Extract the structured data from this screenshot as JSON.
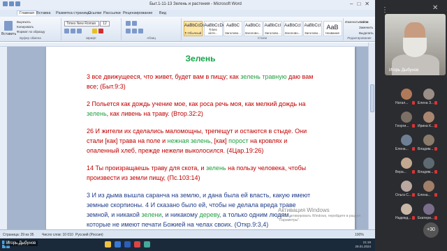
{
  "word": {
    "window_title": "Быт.1-11-13 Зелень и растения - Microsoft Word",
    "tabs": [
      "Главная",
      "Вставка",
      "Разметка страницы",
      "Ссылки",
      "Рассылки",
      "Рецензирование",
      "Вид"
    ],
    "font_name": "Times New Roman",
    "font_size": "12",
    "styles": [
      {
        "preview": "AaBbCcDc",
        "label": "¶ Обычный"
      },
      {
        "preview": "AaBbCcDc",
        "label": "¶ Без инте..."
      },
      {
        "preview": "AaBbC",
        "label": "Заголово..."
      },
      {
        "preview": "AaBbCc",
        "label": "Заголово..."
      },
      {
        "preview": "AaBbCcI",
        "label": "Заголово..."
      },
      {
        "preview": "AaBbCcI",
        "label": "Заголово..."
      },
      {
        "preview": "AaBbCcI",
        "label": "Заголово..."
      },
      {
        "preview": "AaB",
        "label": "Название"
      }
    ],
    "groups": [
      "Буфер обмена",
      "Шрифт",
      "Абзац",
      "Стили",
      "Редактирование"
    ],
    "clipboard": {
      "paste": "Вставить",
      "cut": "Вырезать",
      "copy": "Копировать",
      "format": "Формат по образцу"
    },
    "change_styles": "Изменить стили",
    "editing": {
      "find": "Найти",
      "replace": "Заменить",
      "select": "Выделить"
    },
    "status": {
      "page": "Страница: 29 из 35",
      "words": "Число слов: 10 010",
      "language": "Русский (Россия)",
      "zoom": "100%"
    }
  },
  "document": {
    "title": "Зелень",
    "paragraphs": [
      [
        {
          "t": "3 все движущееся, что живет, будет вам в пищу; как ",
          "c": "red"
        },
        {
          "t": "зелень травную",
          "c": "green"
        },
        {
          "t": " даю вам все; (Быт.9:3)",
          "c": "red"
        }
      ],
      [
        {
          "t": "2 Польется как дождь учение мое, как роса речь моя, как мелкий дождь на ",
          "c": "red"
        },
        {
          "t": "зелень",
          "c": "green"
        },
        {
          "t": ", как ливень на траву. (Втор.32:2)",
          "c": "red"
        }
      ],
      [
        {
          "t": "26 И жители их сделались маломощны, трепещут и остаются в стыде. Они стали [как] трава на поле и ",
          "c": "red"
        },
        {
          "t": "нежная зелень",
          "c": "green"
        },
        {
          "t": ", [как] ",
          "c": "red"
        },
        {
          "t": "порост",
          "c": "green"
        },
        {
          "t": " на кровлях и опаленный хлеб, прежде нежели выколосился. (4Цар.19:26)",
          "c": "red"
        }
      ],
      [
        {
          "t": "14 Ты произращаешь траву для скота, и ",
          "c": "red"
        },
        {
          "t": "зелень",
          "c": "green"
        },
        {
          "t": " на пользу человека, чтобы произвести из земли пищу, (Пс.103:14)",
          "c": "red"
        }
      ],
      [
        {
          "t": "3 И из дыма вышла саранча на землю, и дана была ей власть, какую имеют земные скорпионы. 4 И сказано было ей, чтобы не делала вреда траве земной, и никакой ",
          "c": "blue"
        },
        {
          "t": "зелени",
          "c": "green"
        },
        {
          "t": ", и никакому ",
          "c": "blue"
        },
        {
          "t": "дереву",
          "c": "green"
        },
        {
          "t": ", а только одним людям, которые не имеют печати Божией на челах своих. (Откр.9:3,4)",
          "c": "blue"
        }
      ]
    ]
  },
  "activation": {
    "title": "Активация Windows",
    "sub": "Чтобы активировать Windows, перейдите в раздел \"Параметры\"."
  },
  "taskbar": {
    "search": "Поиск",
    "time": "21:19",
    "date": "29.01.2024"
  },
  "presenter_label": "Игорь Дыбунов",
  "meeting": {
    "main_speaker": "Игорь Дыбунов",
    "participants": [
      {
        "name": "Натал...",
        "color": "#b07a5a"
      },
      {
        "name": "Елена З...",
        "color": "#9a8e86"
      },
      {
        "name": "Георги...",
        "color": "#7c7066"
      },
      {
        "name": "Ирина К...",
        "color": "#a88670"
      },
      {
        "name": "Елена...",
        "color": "#6e7f95"
      },
      {
        "name": "Владим...",
        "color": "#8a7b6a"
      },
      {
        "name": "Вера...",
        "color": "#c2a890"
      },
      {
        "name": "Владим...",
        "color": "#5e6a72"
      },
      {
        "name": "Ольга С...",
        "color": "#b8a8a0"
      },
      {
        "name": "Елена...",
        "color": "#a07e68"
      },
      {
        "name": "Надежд...",
        "color": "#c9b8a5"
      },
      {
        "name": "Екатери...",
        "color": "#7a6e8a"
      }
    ],
    "more_count": "+30"
  },
  "colors": {
    "red": "#c00000",
    "green": "#20a040",
    "blue": "#1f3d8c",
    "title_green": "#16a34a"
  }
}
